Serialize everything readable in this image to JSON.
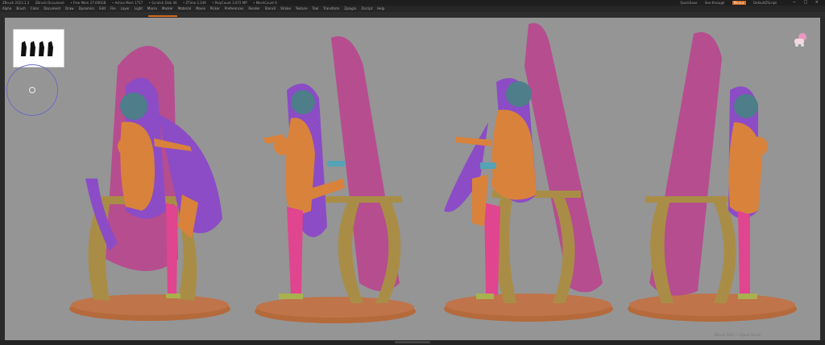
{
  "titlebar": {
    "app": "ZBrush 2023.1.2",
    "document": "ZBrush Document",
    "stats": [
      "• Free Mem 27.000GB",
      "• Active Mem 1717",
      "• Scratch Disk 46",
      "• ZTime 2.249",
      "• PolyCount 3.072 MP",
      "• MeshCount 6"
    ],
    "right_items": [
      "QuickSave",
      "See-through",
      "Menus",
      "DefaultZScript"
    ],
    "right_highlight": "Menus",
    "window_controls": "− □ ×"
  },
  "menubar": {
    "items": [
      "Alpha",
      "Brush",
      "Color",
      "Document",
      "Draw",
      "Dynamics",
      "Edit",
      "File",
      "Layer",
      "Light",
      "Macro",
      "Marker",
      "Material",
      "Movie",
      "Picker",
      "Preferences",
      "Render",
      "Stencil",
      "Stroke",
      "Texture",
      "Tool",
      "Transform",
      "Zplugin",
      "Zscript",
      "Help"
    ]
  },
  "viewport": {
    "background": "#959595",
    "floor_watermark": "ZBrush 2023 — Figure Studio"
  },
  "colors": {
    "accent": "#d26a1e",
    "surfboard": "#b64d8f",
    "skin": "#d9823c",
    "hair": "#8b4cc6",
    "stocking": "#e0458f",
    "stand": "#a98d46",
    "base": "#b56a3c",
    "head": "#4d7e8a",
    "nav_ring": "#6c6cbf"
  }
}
